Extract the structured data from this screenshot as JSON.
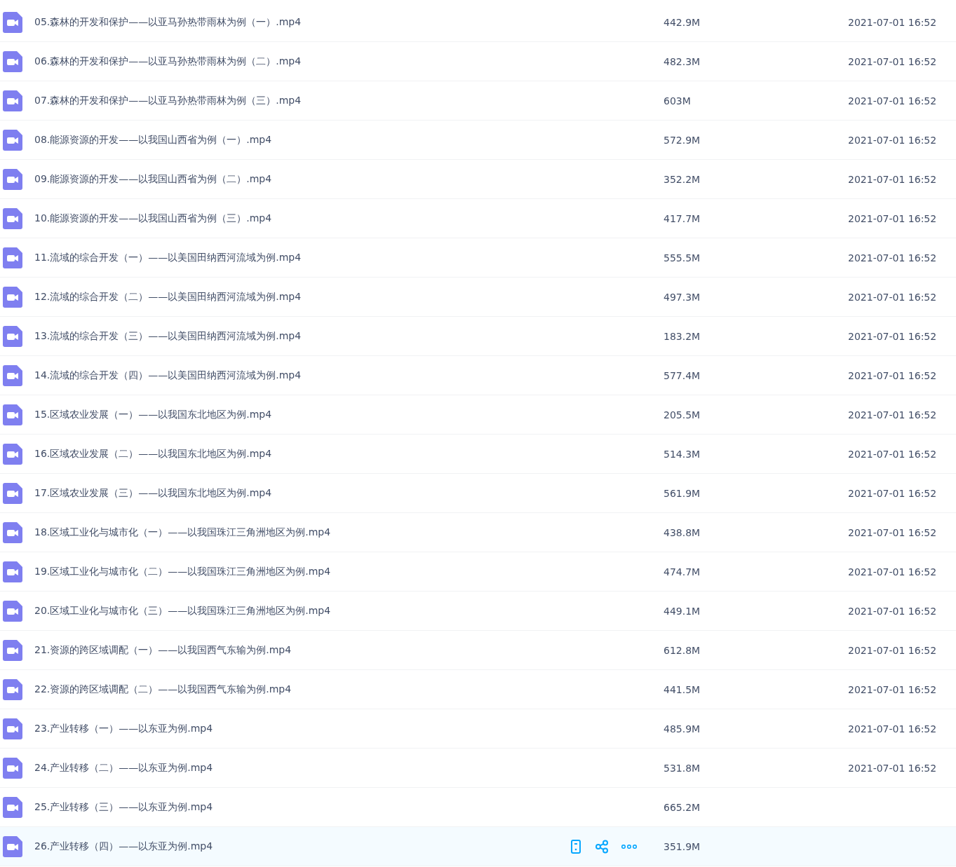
{
  "files": [
    {
      "name": "05.森林的开发和保护——以亚马孙热带雨林为例（一）.mp4",
      "size": "442.9M",
      "date": "2021-07-01 16:52",
      "selected": false
    },
    {
      "name": "06.森林的开发和保护——以亚马孙热带雨林为例（二）.mp4",
      "size": "482.3M",
      "date": "2021-07-01 16:52",
      "selected": false
    },
    {
      "name": "07.森林的开发和保护——以亚马孙热带雨林为例（三）.mp4",
      "size": "603M",
      "date": "2021-07-01 16:52",
      "selected": false
    },
    {
      "name": "08.能源资源的开发——以我国山西省为例（一）.mp4",
      "size": "572.9M",
      "date": "2021-07-01 16:52",
      "selected": false
    },
    {
      "name": "09.能源资源的开发——以我国山西省为例（二）.mp4",
      "size": "352.2M",
      "date": "2021-07-01 16:52",
      "selected": false
    },
    {
      "name": "10.能源资源的开发——以我国山西省为例（三）.mp4",
      "size": "417.7M",
      "date": "2021-07-01 16:52",
      "selected": false
    },
    {
      "name": "11.流域的综合开发（一）——以美国田纳西河流域为例.mp4",
      "size": "555.5M",
      "date": "2021-07-01 16:52",
      "selected": false
    },
    {
      "name": "12.流域的综合开发（二）——以美国田纳西河流域为例.mp4",
      "size": "497.3M",
      "date": "2021-07-01 16:52",
      "selected": false
    },
    {
      "name": "13.流域的综合开发（三）——以美国田纳西河流域为例.mp4",
      "size": "183.2M",
      "date": "2021-07-01 16:52",
      "selected": false
    },
    {
      "name": "14.流域的综合开发（四）——以美国田纳西河流域为例.mp4",
      "size": "577.4M",
      "date": "2021-07-01 16:52",
      "selected": false
    },
    {
      "name": "15.区域农业发展（一）——以我国东北地区为例.mp4",
      "size": "205.5M",
      "date": "2021-07-01 16:52",
      "selected": false
    },
    {
      "name": "16.区域农业发展（二）——以我国东北地区为例.mp4",
      "size": "514.3M",
      "date": "2021-07-01 16:52",
      "selected": false
    },
    {
      "name": "17.区域农业发展（三）——以我国东北地区为例.mp4",
      "size": "561.9M",
      "date": "2021-07-01 16:52",
      "selected": false
    },
    {
      "name": "18.区域工业化与城市化（一）——以我国珠江三角洲地区为例.mp4",
      "size": "438.8M",
      "date": "2021-07-01 16:52",
      "selected": false
    },
    {
      "name": "19.区域工业化与城市化（二）——以我国珠江三角洲地区为例.mp4",
      "size": "474.7M",
      "date": "2021-07-01 16:52",
      "selected": false
    },
    {
      "name": "20.区域工业化与城市化（三）——以我国珠江三角洲地区为例.mp4",
      "size": "449.1M",
      "date": "2021-07-01 16:52",
      "selected": false
    },
    {
      "name": "21.资源的跨区域调配（一）——以我国西气东输为例.mp4",
      "size": "612.8M",
      "date": "2021-07-01 16:52",
      "selected": false
    },
    {
      "name": "22.资源的跨区域调配（二）——以我国西气东输为例.mp4",
      "size": "441.5M",
      "date": "2021-07-01 16:52",
      "selected": false
    },
    {
      "name": "23.产业转移（一）——以东亚为例.mp4",
      "size": "485.9M",
      "date": "2021-07-01 16:52",
      "selected": false
    },
    {
      "name": "24.产业转移（二）——以东亚为例.mp4",
      "size": "531.8M",
      "date": "2021-07-01 16:52",
      "selected": false
    },
    {
      "name": "25.产业转移（三）——以东亚为例.mp4",
      "size": "665.2M",
      "selected": false
    },
    {
      "name": "26.产业转移（四）——以东亚为例.mp4",
      "size": "351.9M",
      "selected": true
    }
  ]
}
